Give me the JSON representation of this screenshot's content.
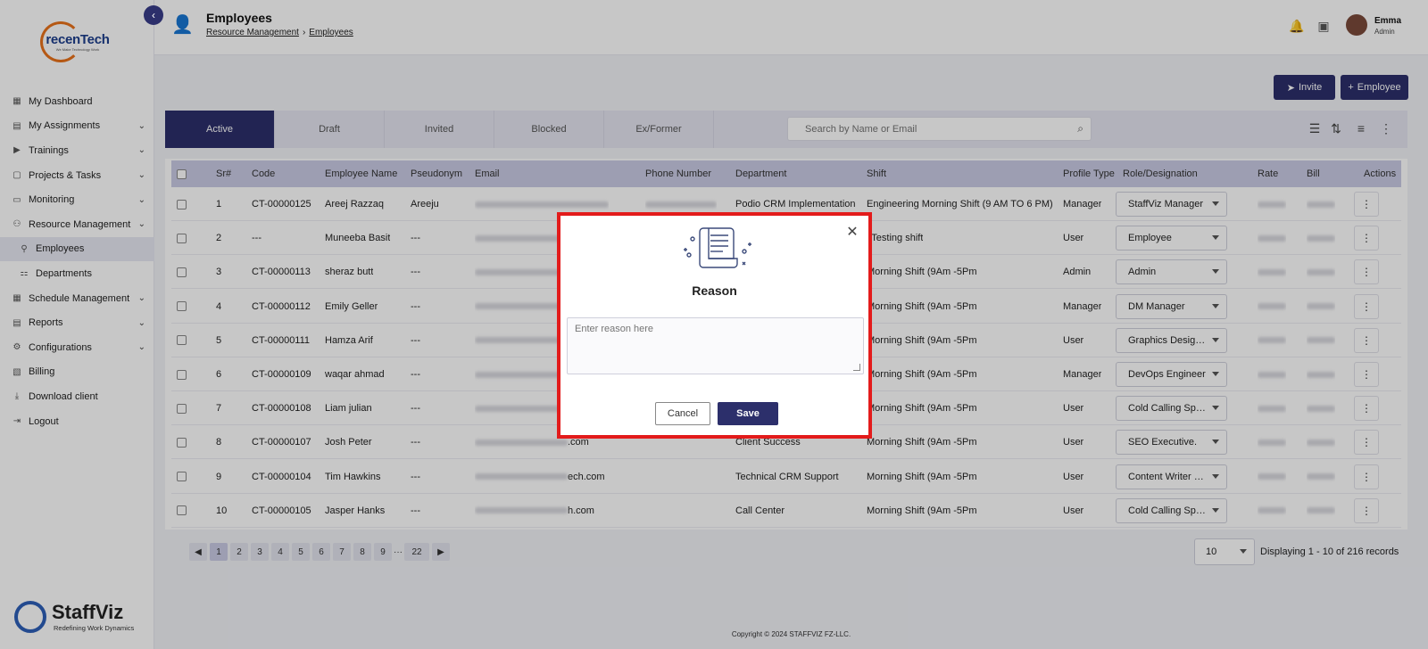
{
  "sidebar": {
    "logo_brand": "recenTech",
    "logo_tagline": "We Make Technology Work",
    "items": [
      {
        "label": "My Dashboard",
        "icon": "dashboard-icon",
        "expandable": false
      },
      {
        "label": "My Assignments",
        "icon": "assignments-icon",
        "expandable": true
      },
      {
        "label": "Trainings",
        "icon": "trainings-icon",
        "expandable": true
      },
      {
        "label": "Projects & Tasks",
        "icon": "projects-icon",
        "expandable": true
      },
      {
        "label": "Monitoring",
        "icon": "monitoring-icon",
        "expandable": true
      },
      {
        "label": "Resource Management",
        "icon": "resource-icon",
        "expandable": true
      },
      {
        "label": "Employees",
        "icon": "employees-icon",
        "expandable": false,
        "sub": true,
        "active": true
      },
      {
        "label": "Departments",
        "icon": "departments-icon",
        "expandable": false,
        "sub": true
      },
      {
        "label": "Schedule Management",
        "icon": "schedule-icon",
        "expandable": true
      },
      {
        "label": "Reports",
        "icon": "reports-icon",
        "expandable": true
      },
      {
        "label": "Configurations",
        "icon": "configurations-icon",
        "expandable": true
      },
      {
        "label": "Billing",
        "icon": "billing-icon",
        "expandable": false
      },
      {
        "label": "Download client",
        "icon": "download-icon",
        "expandable": false
      },
      {
        "label": "Logout",
        "icon": "logout-icon",
        "expandable": false
      }
    ],
    "bottom_brand": "StaffViz",
    "bottom_tagline": "Redefining Work Dynamics"
  },
  "header": {
    "title": "Employees",
    "breadcrumb": [
      "Resource Management",
      "Employees"
    ],
    "user_name": "Emma",
    "user_role": "Admin"
  },
  "actions": {
    "invite_label": "Invite",
    "add_employee_label": "Employee"
  },
  "tabs": [
    "Active",
    "Draft",
    "Invited",
    "Blocked",
    "Ex/Former"
  ],
  "search": {
    "placeholder": "Search by Name or Email",
    "value": ""
  },
  "table": {
    "columns": [
      "Sr#",
      "Code",
      "Employee Name",
      "Pseudonym",
      "Email",
      "Phone Number",
      "Department",
      "Shift",
      "Profile Type",
      "Role/Designation",
      "Rate",
      "Bill",
      "Actions"
    ],
    "rows": [
      {
        "sr": "1",
        "code": "CT-00000125",
        "name": "Areej Razzaq",
        "pseudonym": "Areeju",
        "email_suffix": "",
        "department": "Podio CRM Implementation",
        "shift": "Engineering Morning Shift (9 AM TO 6 PM)",
        "profile": "Manager",
        "role": "StaffViz Manager"
      },
      {
        "sr": "2",
        "code": "---",
        "name": "Muneeba Basit",
        "pseudonym": "---",
        "email_suffix": "",
        "department": "",
        "shift": "l Testing shift",
        "profile": "User",
        "role": "Employee"
      },
      {
        "sr": "3",
        "code": "CT-00000113",
        "name": "sheraz butt",
        "pseudonym": "---",
        "email_suffix": "",
        "department": "",
        "shift": "Morning Shift (9Am -5Pm",
        "profile": "Admin",
        "role": "Admin"
      },
      {
        "sr": "4",
        "code": "CT-00000112",
        "name": "Emily Geller",
        "pseudonym": "---",
        "email_suffix": "",
        "department": "",
        "shift": "Morning Shift (9Am -5Pm",
        "profile": "Manager",
        "role": "DM Manager"
      },
      {
        "sr": "5",
        "code": "CT-00000111",
        "name": "Hamza Arif",
        "pseudonym": "---",
        "email_suffix": "",
        "department": "",
        "shift": "Morning Shift (9Am -5Pm",
        "profile": "User",
        "role": "Graphics Designer"
      },
      {
        "sr": "6",
        "code": "CT-00000109",
        "name": "waqar ahmad",
        "pseudonym": "---",
        "email_suffix": "",
        "department": "",
        "shift": "Morning Shift (9Am -5Pm",
        "profile": "Manager",
        "role": "DevOps Engineer"
      },
      {
        "sr": "7",
        "code": "CT-00000108",
        "name": "Liam julian",
        "pseudonym": "---",
        "email_suffix": "",
        "department": "",
        "shift": "Morning Shift (9Am -5Pm",
        "profile": "User",
        "role": "Cold Calling Speci..."
      },
      {
        "sr": "8",
        "code": "CT-00000107",
        "name": "Josh Peter",
        "pseudonym": "---",
        "email_suffix": ".com",
        "department": "Client Success",
        "shift": "Morning Shift (9Am -5Pm",
        "profile": "User",
        "role": "SEO Executive."
      },
      {
        "sr": "9",
        "code": "CT-00000104",
        "name": "Tim Hawkins",
        "pseudonym": "---",
        "email_suffix": "ech.com",
        "department": "Technical CRM Support",
        "shift": "Morning Shift (9Am -5Pm",
        "profile": "User",
        "role": "Content Writer Exe..."
      },
      {
        "sr": "10",
        "code": "CT-00000105",
        "name": "Jasper Hanks",
        "pseudonym": "---",
        "email_suffix": "h.com",
        "department": "Call Center",
        "shift": "Morning Shift (9Am -5Pm",
        "profile": "User",
        "role": "Cold Calling Speci..."
      }
    ]
  },
  "pagination": {
    "prev": "◀",
    "next": "▶",
    "pages": [
      "1",
      "2",
      "3",
      "4",
      "5",
      "6",
      "7",
      "8",
      "9"
    ],
    "ellipsis": "···",
    "last": "22",
    "per_page": "10",
    "records": "Displaying 1 - 10 of 216 records"
  },
  "footer": "Copyright © 2024 STAFFVIZ FZ-LLC.",
  "modal": {
    "title": "Reason",
    "placeholder": "Enter reason here",
    "value": "",
    "cancel_label": "Cancel",
    "save_label": "Save",
    "highlight_color": "#e31b1b"
  },
  "colors": {
    "primary": "#2c2f6b",
    "accent": "#e8711a"
  }
}
